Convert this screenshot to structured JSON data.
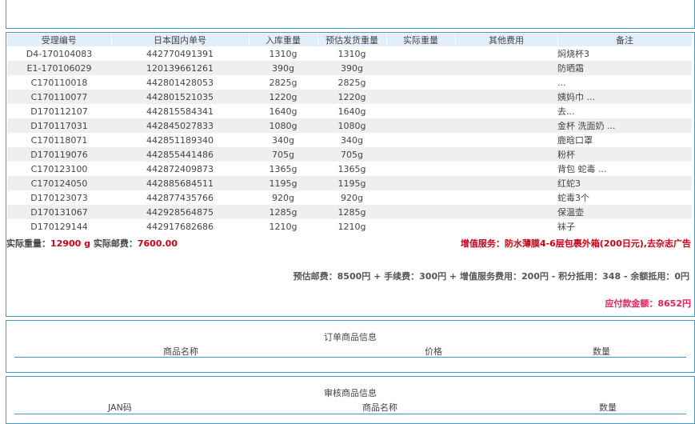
{
  "shipment": {
    "columns": [
      "受理编号",
      "日本国内单号",
      "入库重量",
      "预估发货重量",
      "实际重量",
      "其他费用",
      "备注"
    ],
    "rows": [
      {
        "id": "D4-170104083",
        "jp_no": "442770491391",
        "in_weight": "1310g",
        "est_weight": "1310g",
        "actual": "",
        "other": "",
        "note": "焖烧杯3"
      },
      {
        "id": "E1-170106029",
        "jp_no": "120139661261",
        "in_weight": "390g",
        "est_weight": "390g",
        "actual": "",
        "other": "",
        "note": "防晒霜"
      },
      {
        "id": "C170110018",
        "jp_no": "442801428053",
        "in_weight": "2825g",
        "est_weight": "2825g",
        "actual": "",
        "other": "",
        "note": "..."
      },
      {
        "id": "C170110077",
        "jp_no": "442801521035",
        "in_weight": "1220g",
        "est_weight": "1220g",
        "actual": "",
        "other": "",
        "note": "姨妈巾 ..."
      },
      {
        "id": "D170112107",
        "jp_no": "442815584341",
        "in_weight": "1640g",
        "est_weight": "1640g",
        "actual": "",
        "other": "",
        "note": "去..."
      },
      {
        "id": "D170117031",
        "jp_no": "442845027833",
        "in_weight": "1080g",
        "est_weight": "1080g",
        "actual": "",
        "other": "",
        "note": "金杯 洗面奶 ..."
      },
      {
        "id": "C170118071",
        "jp_no": "442851189340",
        "in_weight": "340g",
        "est_weight": "340g",
        "actual": "",
        "other": "",
        "note": "鹿晗口罩"
      },
      {
        "id": "D170119076",
        "jp_no": "442855441486",
        "in_weight": "705g",
        "est_weight": "705g",
        "actual": "",
        "other": "",
        "note": "粉杯"
      },
      {
        "id": "C170123100",
        "jp_no": "442872409873",
        "in_weight": "1365g",
        "est_weight": "1365g",
        "actual": "",
        "other": "",
        "note": "背包 蛇毒 ..."
      },
      {
        "id": "C170124050",
        "jp_no": "442885684511",
        "in_weight": "1195g",
        "est_weight": "1195g",
        "actual": "",
        "other": "",
        "note": "红蛇3"
      },
      {
        "id": "D170123073",
        "jp_no": "442877435766",
        "in_weight": "920g",
        "est_weight": "920g",
        "actual": "",
        "other": "",
        "note": "蛇毒3个"
      },
      {
        "id": "D170131067",
        "jp_no": "442928564875",
        "in_weight": "1285g",
        "est_weight": "1285g",
        "actual": "",
        "other": "",
        "note": "保温壶"
      },
      {
        "id": "D170129144",
        "jp_no": "442917682686",
        "in_weight": "1210g",
        "est_weight": "1210g",
        "actual": "",
        "other": "",
        "note": "袜子"
      }
    ]
  },
  "summary": {
    "weight_label": "实际重量：",
    "weight_value": "12900 g",
    "postage_label": "实际邮费：",
    "postage_value": "7600.00",
    "service_text": "增值服务：防水薄膜4-6层包裹外箱(200日元),去杂志广告",
    "calc_text": "预估邮费：8500円 + 手续费：300円 + 增值服务费用：200円 - 积分抵用：348 - 余额抵用：0円",
    "due_text": "应付款金额：8652円"
  },
  "order_info": {
    "title": "订单商品信息",
    "col_name": "商品名称",
    "col_price": "价格",
    "col_qty": "数量"
  },
  "audit_info": {
    "title": "审核商品信息",
    "col_jan": "JAN码",
    "col_name": "商品名称",
    "col_qty": "数量"
  },
  "colors": {
    "border": "#3d9ad1",
    "header_bg": "#e3eefa",
    "alert_red": "#d0021b",
    "due_pink": "#e0245e"
  }
}
